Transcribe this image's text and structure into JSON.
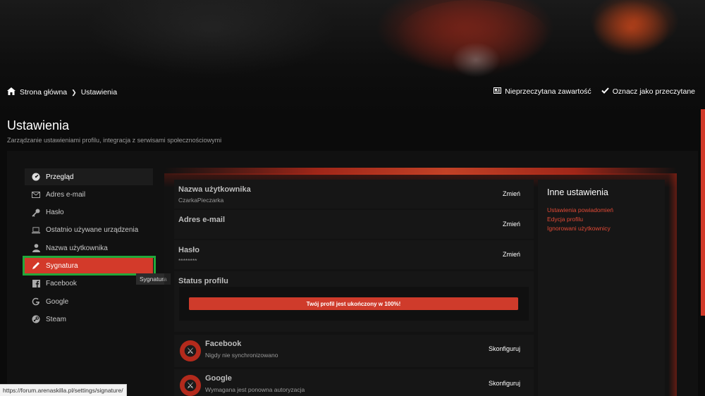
{
  "breadcrumb": {
    "home": "Strona główna",
    "current": "Ustawienia"
  },
  "top_actions": {
    "unread": "Nieprzeczytana zawartość",
    "mark_read": "Oznacz jako przeczytane"
  },
  "page": {
    "title": "Ustawienia",
    "subtitle": "Zarządzanie ustawieniami profilu, integracja z serwisami społecznościowymi"
  },
  "sidebar": {
    "items": [
      {
        "label": "Przegląd",
        "icon": "dashboard-icon"
      },
      {
        "label": "Adres e-mail",
        "icon": "envelope-icon"
      },
      {
        "label": "Hasło",
        "icon": "key-icon"
      },
      {
        "label": "Ostatnio używane urządzenia",
        "icon": "laptop-icon"
      },
      {
        "label": "Nazwa użytkownika",
        "icon": "user-icon"
      },
      {
        "label": "Sygnatura",
        "icon": "pencil-icon"
      },
      {
        "label": "Facebook",
        "icon": "facebook-icon"
      },
      {
        "label": "Google",
        "icon": "google-icon"
      },
      {
        "label": "Steam",
        "icon": "steam-icon"
      }
    ],
    "tooltip": "Sygnatura"
  },
  "main": {
    "username": {
      "label": "Nazwa użytkownika",
      "value": "CzarkaPieczarka",
      "action": "Zmień"
    },
    "email": {
      "label": "Adres e-mail",
      "action": "Zmień"
    },
    "password": {
      "label": "Hasło",
      "value": "********",
      "action": "Zmień"
    },
    "status": {
      "label": "Status profilu",
      "progress_text": "Twój profil jest ukończony w 100%!",
      "progress": 1.0
    },
    "facebook": {
      "label": "Facebook",
      "value": "Nigdy nie synchronizowano",
      "action": "Skonfiguruj"
    },
    "google": {
      "label": "Google",
      "value": "Wymagana jest ponowna autoryzacja",
      "action": "Skonfiguruj"
    }
  },
  "right_box": {
    "title": "Inne ustawienia",
    "links": [
      "Ustawienia powiadomień",
      "Edycja profilu",
      "Ignorowani użytkownicy"
    ]
  },
  "status_url": "https://forum.arenaskilla.pl/settings/signature/",
  "colors": {
    "accent": "#d33a2a",
    "highlight_border": "#22a83a",
    "link": "#e24a36"
  }
}
